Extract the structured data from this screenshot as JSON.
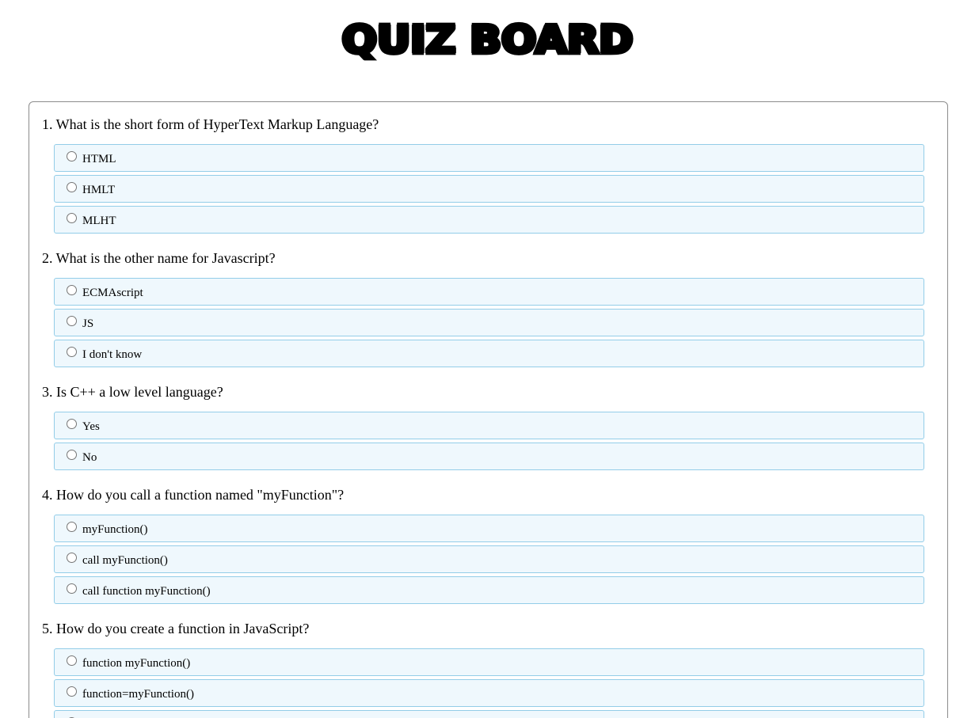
{
  "header": {
    "title": "QUIZ BOARD"
  },
  "questions": [
    {
      "label": "1. What is the short form of HyperText Markup Language?",
      "options": [
        "HTML",
        "HMLT",
        "MLHT"
      ]
    },
    {
      "label": "2. What is the other name for Javascript?",
      "options": [
        "ECMAscript",
        "JS",
        "I don't know"
      ]
    },
    {
      "label": "3. Is C++ a low level language?",
      "options": [
        "Yes",
        "No"
      ]
    },
    {
      "label": "4. How do you call a function named \"myFunction\"?",
      "options": [
        "myFunction()",
        "call myFunction()",
        "call function myFunction()"
      ]
    },
    {
      "label": "5. How do you create a function in JavaScript?",
      "options": [
        "function myFunction()",
        "function=myFunction()",
        ""
      ]
    }
  ],
  "colors": {
    "option_background": "#eff8fd",
    "option_border": "#93cde8",
    "card_border": "#8c8c8c"
  }
}
